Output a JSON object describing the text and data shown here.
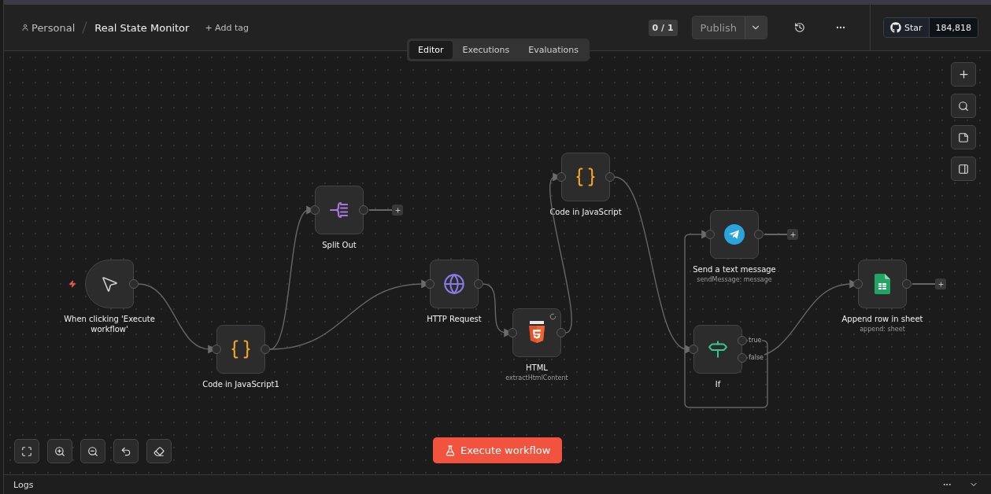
{
  "breadcrumb": {
    "project": "Personal",
    "workflow": "Real State Monitor",
    "add_tag": "+ Add tag"
  },
  "tabs": [
    {
      "label": "Editor",
      "selected": true
    },
    {
      "label": "Executions",
      "selected": false
    },
    {
      "label": "Evaluations",
      "selected": false
    }
  ],
  "header": {
    "version_counter": "0 / 1",
    "publish": "Publish",
    "github": {
      "label": "Star",
      "count": "184,818"
    }
  },
  "nodes": [
    {
      "kind": "trigger",
      "label": "When clicking 'Execute workflow'",
      "open_output": false
    },
    {
      "kind": "code",
      "label": "Code in JavaScript1",
      "open_output": false
    },
    {
      "kind": "split",
      "label": "Split Out",
      "open_output": true
    },
    {
      "kind": "http",
      "label": "HTTP Request",
      "open_output": false
    },
    {
      "kind": "html",
      "label": "HTML",
      "subtitle": "extractHtmlContent",
      "open_output": false
    },
    {
      "kind": "code",
      "label": "Code in JavaScript",
      "open_output": false
    },
    {
      "kind": "telegram",
      "label": "Send a text message",
      "subtitle": "sendMessage: message",
      "open_output": true
    },
    {
      "kind": "if",
      "label": "If",
      "outputs": [
        "true",
        "false"
      ],
      "open_output": false
    },
    {
      "kind": "sheets",
      "label": "Append row in sheet",
      "subtitle": "append: sheet",
      "open_output": true
    }
  ],
  "execute_button": "Execute workflow",
  "logs": {
    "title": "Logs"
  }
}
